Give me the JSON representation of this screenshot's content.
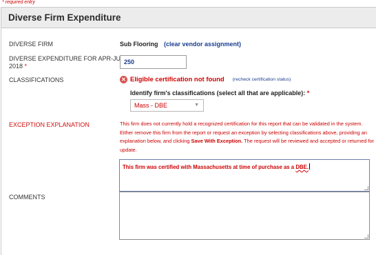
{
  "required_note": "* required entry",
  "panel": {
    "title": "Diverse Firm Expenditure"
  },
  "diverse_firm": {
    "label": "DIVERSE FIRM",
    "vendor_name": "Sub Flooring",
    "clear_link": "(clear vendor assignment)"
  },
  "expenditure": {
    "label_line1": "DIVERSE EXPENDITURE FOR APR-JUN",
    "label_line2": "2018",
    "required_star": "*",
    "value": "250"
  },
  "classifications": {
    "label": "CLASSIFICATIONS",
    "error_icon": "x-circle-icon",
    "error_text": "Eligible certification not found",
    "recheck_link": "(recheck certification status)",
    "identify_text": "Identify firm's classifications (select all that are applicable):",
    "required_star": "*",
    "selected_option": "Mass - DBE"
  },
  "exception": {
    "label": "EXCEPTION EXPLANATION",
    "message_part1": "This firm does not currently hold a recognized certification for this report that can be validated in the system. Either remove this firm from the report or request an exception by selecting classifications above, providing an explanation below, and clicking",
    "message_bold": "Save With Exception.",
    "message_part2": "The request will be reviewed and accepted or returned for update.",
    "text_main": "This firm was certified with Massachusetts at time of purchase as a",
    "text_tail": "DBE."
  },
  "comments": {
    "label": "COMMENTS",
    "value": ""
  },
  "colors": {
    "accent_red": "#cc0000",
    "link_blue": "#1a3d8f",
    "header_bg": "#ececec"
  }
}
